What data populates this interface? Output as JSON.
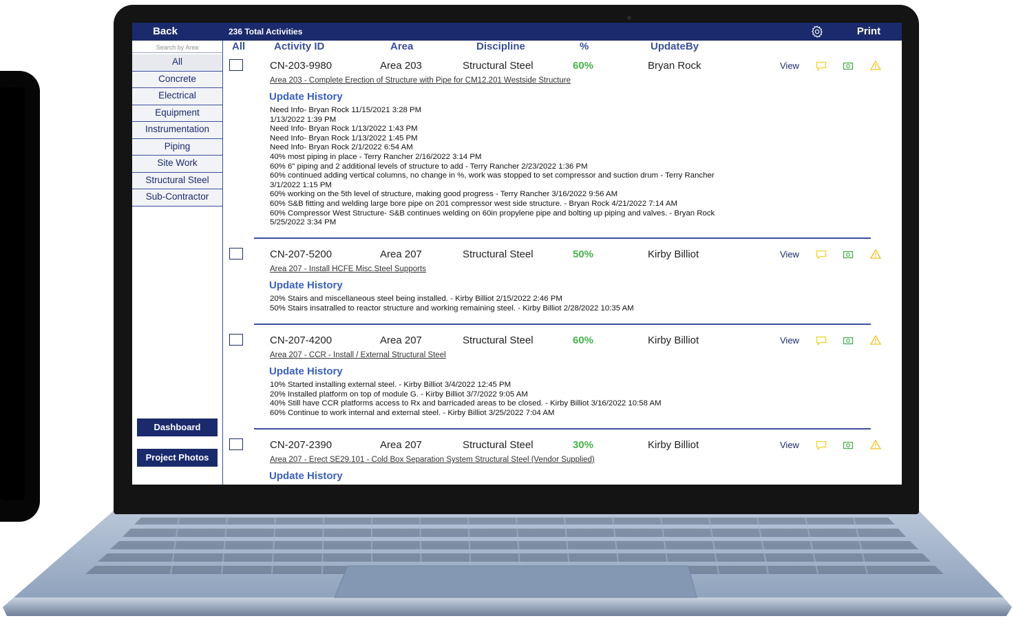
{
  "header": {
    "back_label": "Back",
    "total_label": "236 Total Activities",
    "settings_icon": "gear-icon",
    "print_label": "Print"
  },
  "sidebar": {
    "search_placeholder": "Search by Area",
    "areas": [
      "All",
      "Concrete",
      "Electrical",
      "Equipment",
      "Instrumentation",
      "Piping",
      "Site Work",
      "Structural Steel",
      "Sub-Contractor"
    ],
    "dashboard_label": "Dashboard",
    "project_photos_label": "Project Photos"
  },
  "columns": {
    "all": "All",
    "activity_id": "Activity ID",
    "area": "Area",
    "discipline": "Discipline",
    "percent": "%",
    "update_by": "UpdateBy"
  },
  "colors": {
    "navy": "#1a2a6c",
    "accent_blue": "#3a5fbf",
    "percent_green": "#46b34b",
    "comment_icon": "#f0d230",
    "photo_icon": "#4caf50",
    "warning_icon": "#f3c21c"
  },
  "row_actions": {
    "view_label": "View",
    "icons": [
      "comment-icon",
      "camera-icon",
      "warning-icon"
    ]
  },
  "activities": [
    {
      "id": "CN-203-9980",
      "area": "Area 203",
      "discipline": "Structural Steel",
      "percent": "60%",
      "update_by": "Bryan Rock",
      "description": "Area 203 - Complete Erection of Structure with Pipe for CM12.201 Westside Structure",
      "history_title": "Update History",
      "history": [
        "Need Info- Bryan Rock 11/15/2021 3:28 PM",
        "1/13/2022 1:39 PM",
        "Need Info- Bryan Rock 1/13/2022 1:43 PM",
        "Need Info- Bryan Rock 1/13/2022 1:45 PM",
        "Need Info- Bryan Rock 2/1/2022 6:54 AM",
        "40% most piping in place - Terry Rancher 2/16/2022 3:14 PM",
        "60% 6\" piping and 2 additional levels of structure to add - Terry Rancher 2/23/2022 1:36 PM",
        "60% continued adding vertical columns, no change in %, work was stopped to set compressor and suction drum - Terry Rancher",
        "3/1/2022 1:15 PM",
        "60% working on the 5th level of structure, making good progress - Terry Rancher 3/16/2022 9:56 AM",
        "60% S&B fitting and welding large bore pipe on 201 compressor west side structure. - Bryan Rock 4/21/2022 7:14 AM",
        "60% Compressor West Structure- S&B continues welding on 60in propylene pipe and bolting up piping and valves. - Bryan Rock",
        "5/25/2022 3:34 PM"
      ]
    },
    {
      "id": "CN-207-5200",
      "area": "Area 207",
      "discipline": "Structural Steel",
      "percent": "50%",
      "update_by": "Kirby Billiot",
      "description": "Area 207 - Install HCFE Misc.Steel Supports",
      "history_title": "Update History",
      "history": [
        "20% Stairs and miscellaneous steel being installed. - Kirby Billiot 2/15/2022 2:46 PM",
        "50% Stairs insatralled to reactor structure and working remaining steel. - Kirby Billiot 2/28/2022 10:35 AM"
      ]
    },
    {
      "id": "CN-207-4200",
      "area": "Area 207",
      "discipline": "Structural Steel",
      "percent": "60%",
      "update_by": "Kirby Billiot",
      "description": "Area 207 - CCR - Install / External Structural Steel",
      "history_title": "Update History",
      "history": [
        "10% Started installing external steel. - Kirby Billiot 3/4/2022 12:45 PM",
        "20% Installed platform on top of module G. - Kirby Billiot 3/7/2022 9:05 AM",
        "40% Still have CCR platforms access to Rx and barricaded areas to be closed. - Kirby Billiot 3/16/2022 10:58 AM",
        "60% Continue to work internal and external steel. - Kirby Billiot 3/25/2022 7:04 AM"
      ]
    },
    {
      "id": "CN-207-2390",
      "area": "Area 207",
      "discipline": "Structural Steel",
      "percent": "30%",
      "update_by": "Kirby Billiot",
      "description": "Area 207 - Erect SE29.101 - Cold Box Separation System Structural Steel (Vendor Supplied)",
      "history_title": "Update History",
      "history": []
    }
  ]
}
